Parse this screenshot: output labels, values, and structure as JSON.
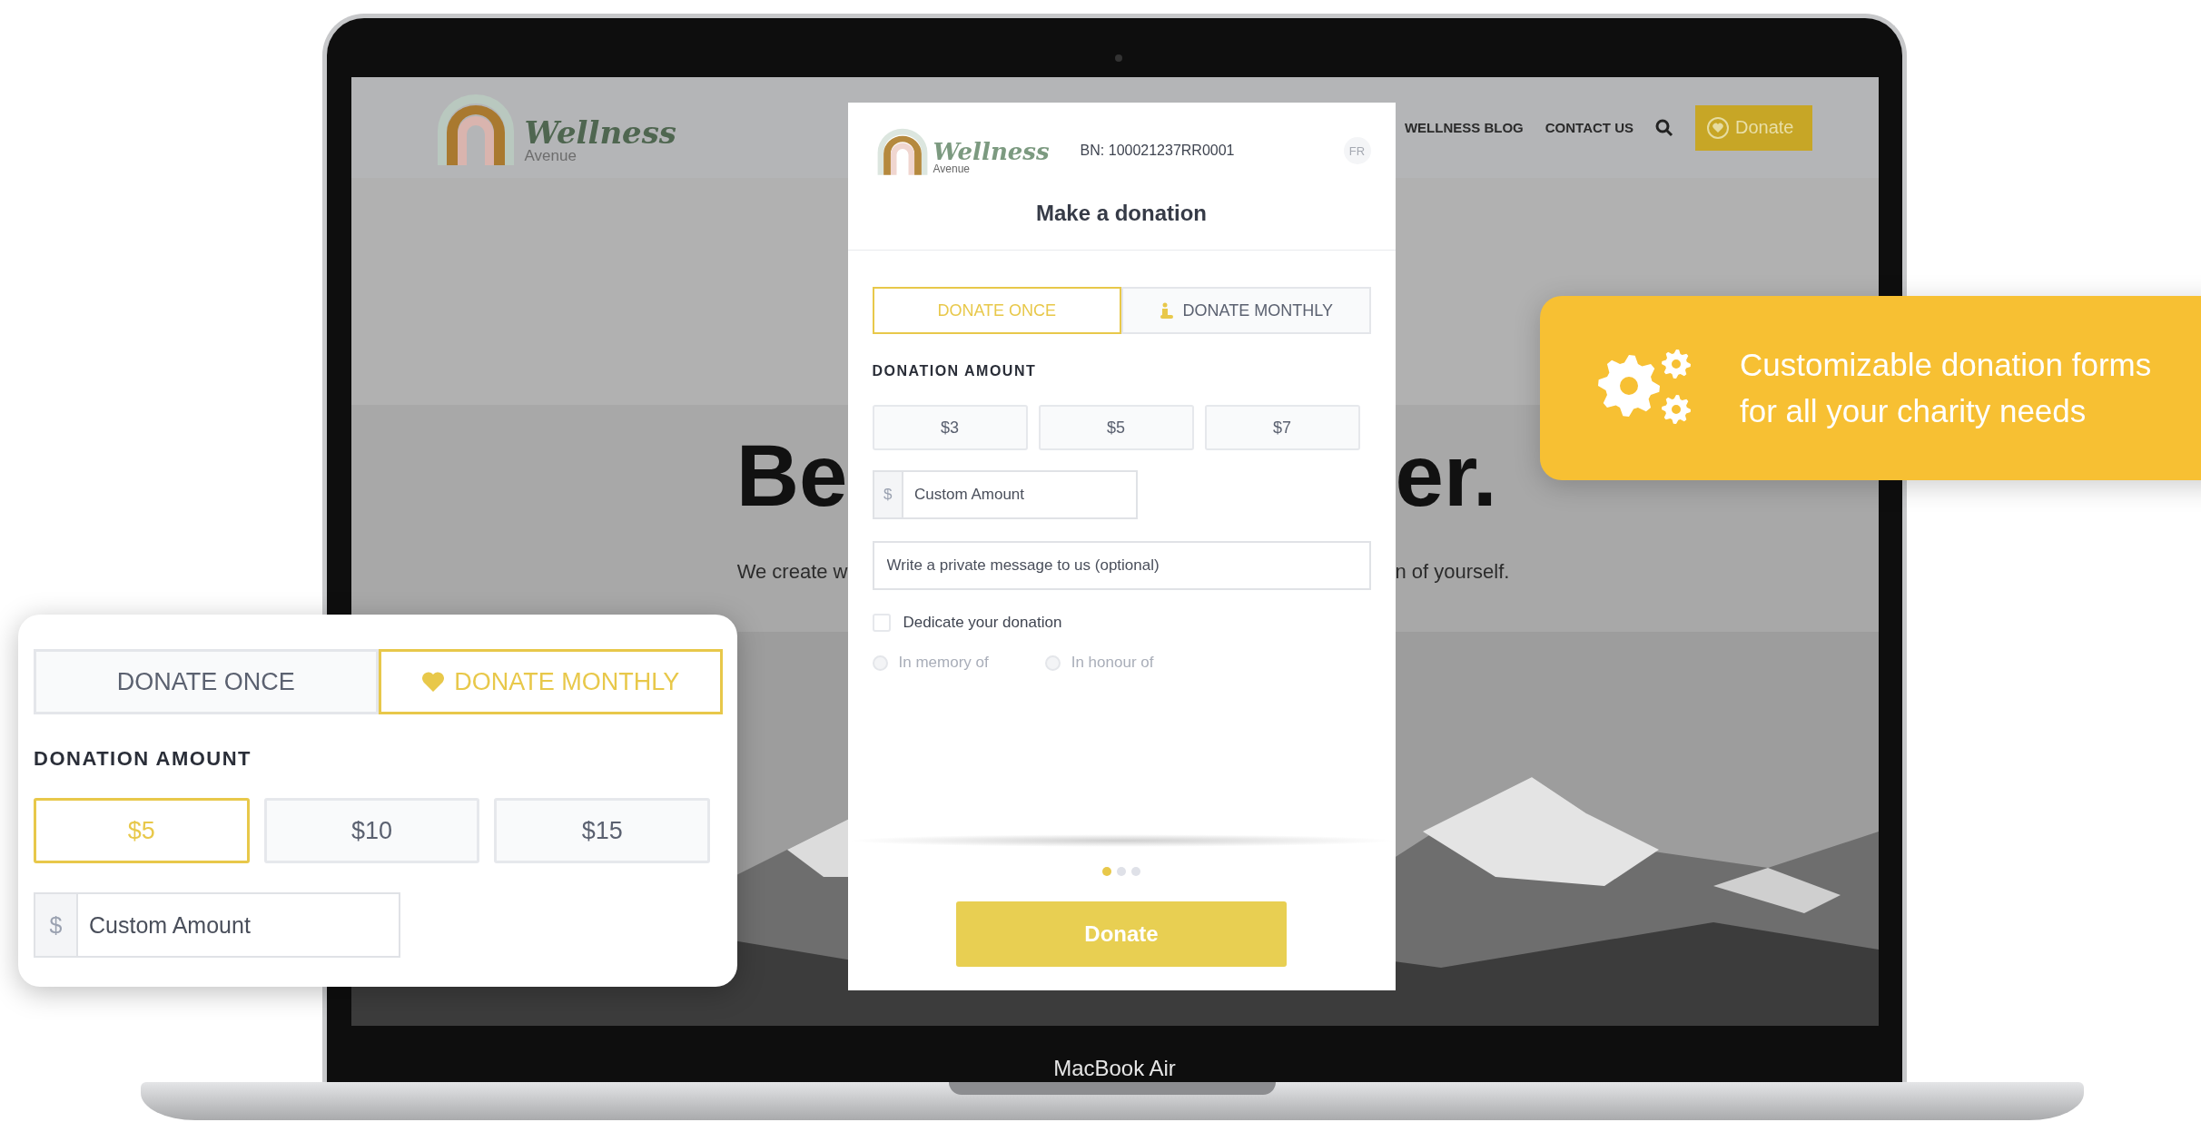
{
  "site": {
    "logo": {
      "name": "Wellness",
      "tagline": "Avenue"
    },
    "nav": [
      {
        "label": "WELLNESS BLOG"
      },
      {
        "label": "CONTACT US"
      }
    ],
    "donate_button": "Donate",
    "hero": {
      "title_left": "Be",
      "title_right": "er.",
      "text_left": "We create w",
      "text_right": "n of yourself."
    }
  },
  "form": {
    "logo": {
      "name": "Wellness",
      "tagline": "Avenue"
    },
    "business_number": "BN: 100021237RR0001",
    "language": "FR",
    "title": "Make a donation",
    "tabs": [
      {
        "label": "DONATE ONCE",
        "selected": true
      },
      {
        "label": "DONATE MONTHLY",
        "selected": false
      }
    ],
    "amount_label": "DONATION AMOUNT",
    "amounts": [
      {
        "label": "$3",
        "selected": false
      },
      {
        "label": "$5",
        "selected": false
      },
      {
        "label": "$7",
        "selected": false
      }
    ],
    "custom_amount": {
      "prefix": "$",
      "placeholder": "Custom Amount"
    },
    "message": {
      "placeholder": "Write a private message to us (optional)"
    },
    "dedicate": {
      "label": "Dedicate your donation",
      "checked": false
    },
    "dedication_options": [
      {
        "label": "In memory of",
        "selected": false,
        "disabled": true
      },
      {
        "label": "In honour of",
        "selected": false,
        "disabled": true
      }
    ],
    "steps": [
      {
        "selected": true
      },
      {
        "selected": false
      },
      {
        "selected": false
      }
    ],
    "submit": "Donate"
  },
  "card": {
    "tabs": [
      {
        "label": "DONATE ONCE",
        "selected": false
      },
      {
        "label": "DONATE MONTHLY",
        "selected": true
      }
    ],
    "amount_label": "DONATION AMOUNT",
    "amounts": [
      {
        "label": "$5",
        "selected": true
      },
      {
        "label": "$10",
        "selected": false
      },
      {
        "label": "$15",
        "selected": false
      }
    ],
    "custom_amount": {
      "prefix": "$",
      "placeholder": "Custom Amount"
    }
  },
  "banner": {
    "text": "Customizable donation forms for all your charity needs"
  },
  "laptop": {
    "model": "MacBook Air"
  }
}
